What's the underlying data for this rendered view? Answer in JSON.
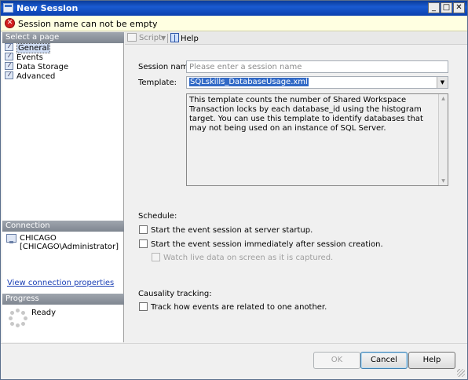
{
  "window": {
    "title": "New Session",
    "minimize": "_",
    "maximize": "□",
    "close": "✕"
  },
  "error": {
    "message": "Session name can not be empty",
    "icon": "error-icon"
  },
  "left": {
    "select_page_header": "Select a page",
    "pages": [
      {
        "label": "General",
        "selected": true
      },
      {
        "label": "Events",
        "selected": false
      },
      {
        "label": "Data Storage",
        "selected": false
      },
      {
        "label": "Advanced",
        "selected": false
      }
    ],
    "connection_header": "Connection",
    "server": "CHICAGO",
    "user": "[CHICAGO\\Administrator]",
    "view_connection_link": "View connection properties",
    "progress_header": "Progress",
    "progress_status": "Ready"
  },
  "toolbar": {
    "script_label": "Script",
    "help_label": "Help"
  },
  "form": {
    "session_name_label": "Session name:",
    "session_name_value": "",
    "session_name_placeholder": "Please enter a session name",
    "template_label": "Template:",
    "template_value": "SQLskills_DatabaseUsage.xml",
    "template_description": "This template counts the number of Shared Workspace Transaction locks by each database_id using the histogram target.  You can use this template to identify databases that may not being used on an instance of SQL Server.",
    "schedule_label": "Schedule:",
    "start_at_startup": {
      "label": "Start the event session at server startup.",
      "checked": false
    },
    "start_immediately": {
      "label": "Start the event session immediately after session creation.",
      "checked": false
    },
    "watch_live": {
      "label": "Watch live data on screen as it is captured.",
      "checked": false,
      "enabled": false
    },
    "causality_label": "Causality tracking:",
    "track_events": {
      "label": "Track how events are related to one another.",
      "checked": false
    }
  },
  "buttons": {
    "ok": "OK",
    "cancel": "Cancel",
    "help": "Help"
  },
  "colors": {
    "title_bar": "#1a5bd1",
    "error_banner": "#ffffe1",
    "section_header": "#8a9099",
    "selection": "#3169c6"
  }
}
